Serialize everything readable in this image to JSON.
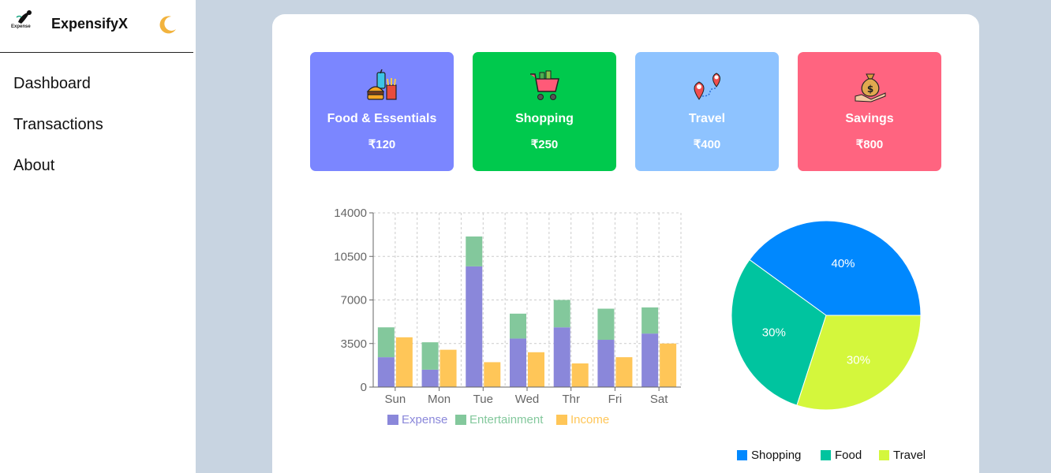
{
  "app": {
    "name": "ExpensifyX",
    "logo_text": "Expense"
  },
  "nav": {
    "items": [
      {
        "label": "Dashboard"
      },
      {
        "label": "Transactions"
      },
      {
        "label": "About"
      }
    ]
  },
  "cards": [
    {
      "label": "Food & Essentials",
      "amount": "₹120",
      "color": "#7b86ff",
      "icon": "food-icon"
    },
    {
      "label": "Shopping",
      "amount": "₹250",
      "color": "#00c94d",
      "icon": "shopping-cart-icon"
    },
    {
      "label": "Travel",
      "amount": "₹400",
      "color": "#8ec3ff",
      "icon": "map-pin-icon"
    },
    {
      "label": "Savings",
      "amount": "₹800",
      "color": "#ff6480",
      "icon": "money-bag-icon"
    }
  ],
  "chart_data": [
    {
      "type": "bar",
      "stacked": true,
      "categories": [
        "Sun",
        "Mon",
        "Tue",
        "Wed",
        "Thr",
        "Fri",
        "Sat"
      ],
      "series": [
        {
          "name": "Expense",
          "stack": "a",
          "color": "#8a87da",
          "values": [
            2400,
            1400,
            9700,
            3900,
            4800,
            3800,
            4300
          ]
        },
        {
          "name": "Entertainment",
          "stack": "a",
          "color": "#83c89c",
          "values": [
            2400,
            2200,
            2400,
            2000,
            2200,
            2500,
            2100
          ]
        },
        {
          "name": "Income",
          "stack": "b",
          "color": "#ffc658",
          "values": [
            4000,
            3000,
            2000,
            2800,
            1900,
            2400,
            3500
          ]
        }
      ],
      "yticks": [
        "0",
        "3500",
        "7000",
        "10500",
        "14000"
      ],
      "ylim": [
        0,
        14000
      ],
      "grid": true,
      "legend": "bottom"
    },
    {
      "type": "pie",
      "labels": [
        "Shopping",
        "Food",
        "Travel"
      ],
      "values": [
        40,
        30,
        30
      ],
      "value_labels": [
        "40%",
        "30%",
        "30%"
      ],
      "colors": [
        "#0088fe",
        "#00c49f",
        "#d4f73c"
      ],
      "legend": "bottom-right"
    }
  ]
}
